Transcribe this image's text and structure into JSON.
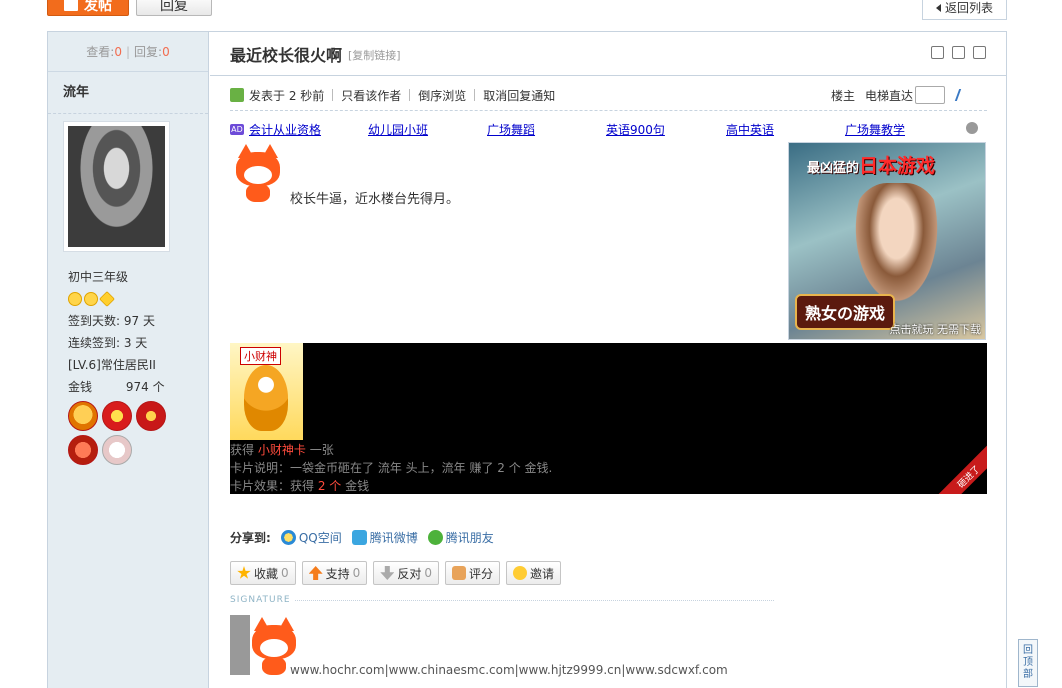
{
  "top": {
    "post_label": "发帖",
    "reply_label": "回复",
    "back_label": "返回列表"
  },
  "left": {
    "views_label": "查看:",
    "views": "0",
    "replies_label": "回复:",
    "replies": "0",
    "author": "流年",
    "grade": "初中三年级",
    "checkin_days": "签到天数: 97 天",
    "streak": "连续签到: 3 天",
    "level": "[LV.6]常住居民II",
    "money_label": "金钱",
    "money_value": "974 个"
  },
  "thread": {
    "title": "最近校长很火啊",
    "copy_link": "[复制链接]",
    "posted": "发表于 2 秒前",
    "only_author": "只看该作者",
    "reverse": "倒序浏览",
    "cancel_notify": "取消回复通知",
    "floor": "楼主",
    "jump_label": "电梯直达"
  },
  "links": [
    "会计从业资格",
    "幼儿园小班",
    "广场舞蹈",
    "英语900句",
    "高中英语",
    "广场舞教学"
  ],
  "post": {
    "text": "校长牛逼，近水楼台先得月。"
  },
  "ad": {
    "top_pre": "最凶猛的",
    "top_main": "日本游戏",
    "bottom": "熟女の游戏",
    "note": "点击就玩 无需下载"
  },
  "card": {
    "tag": "小财神",
    "line1_pre": "获得",
    "line1_hl": "小财神卡",
    "line1_post": "一张",
    "line2": "卡片说明：一袋金币砸在了 流年 头上，流年 赚了 2 个 金钱.",
    "line3_pre": "卡片效果：获得",
    "line3_hl": "2 个",
    "line3_post": "金钱",
    "ribbon": "砸进了"
  },
  "share": {
    "label": "分享到:",
    "items": [
      "QQ空间",
      "腾讯微博",
      "腾讯朋友"
    ]
  },
  "actions": {
    "fav": "收藏",
    "fav_count": "0",
    "support": "支持",
    "support_count": "0",
    "oppose": "反对",
    "oppose_count": "0",
    "rate": "评分",
    "invite": "邀请"
  },
  "signature": {
    "label": "SIGNATURE",
    "text": "www.hochr.com|www.chinaesmc.com|www.hjtz9999.cn|www.sdcwxf.com"
  },
  "totop": {
    "c1": "回",
    "c2": "顶",
    "c3": "部"
  }
}
